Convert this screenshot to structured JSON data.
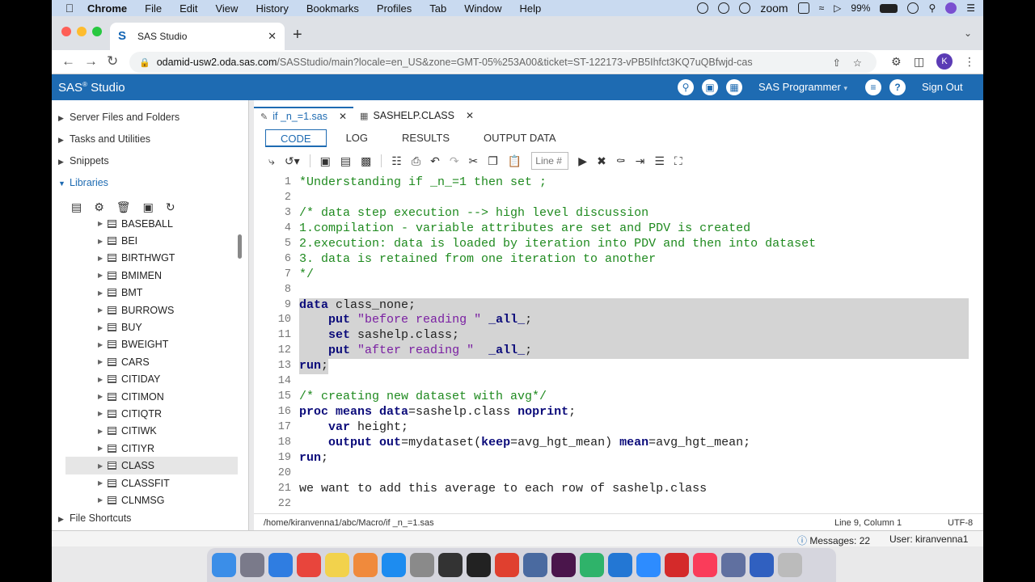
{
  "menubar": {
    "apple": "",
    "items": [
      "Chrome",
      "File",
      "Edit",
      "View",
      "History",
      "Bookmarks",
      "Profiles",
      "Tab",
      "Window",
      "Help"
    ],
    "zoom": "zoom",
    "battery": "99%",
    "time": ""
  },
  "browser": {
    "tab_title": "SAS Studio",
    "url_host": "odamid-usw2.oda.sas.com",
    "url_path": "/SASStudio/main?locale=en_US&zone=GMT-05%253A00&ticket=ST-122173-vPB5Ihfct3KQ7uQBfwjd-cas",
    "profile_initial": "K"
  },
  "sas_header": {
    "brand": "SAS",
    "brand_mark": "®",
    "brand_rest": " Studio",
    "mode": "SAS Programmer",
    "sign_out": "Sign Out"
  },
  "left_panel": {
    "sections": {
      "server_files": "Server Files and Folders",
      "tasks": "Tasks and Utilities",
      "snippets": "Snippets",
      "libraries": "Libraries",
      "file_shortcuts": "File Shortcuts"
    },
    "libraries": [
      "BASEBALL",
      "BEI",
      "BIRTHWGT",
      "BMIMEN",
      "BMT",
      "BURROWS",
      "BUY",
      "BWEIGHT",
      "CARS",
      "CITIDAY",
      "CITIMON",
      "CITIQTR",
      "CITIWK",
      "CITIYR",
      "CLASS",
      "CLASSFIT",
      "CLNMSG"
    ],
    "selected_library": "CLASS"
  },
  "editor": {
    "doc_tabs": [
      "if _n_=1.sas",
      "SASHELP.CLASS"
    ],
    "sub_tabs": [
      "CODE",
      "LOG",
      "RESULTS",
      "OUTPUT DATA"
    ],
    "line_placeholder": "Line #",
    "status_path": "/home/kiranvenna1/abc/Macro/if _n_=1.sas",
    "status_position": "Line 9, Column 1",
    "status_encoding": "UTF-8",
    "lines": [
      {
        "n": "1",
        "segs": [
          {
            "t": "*Understanding if _n_=1 then set ;",
            "c": "com"
          }
        ]
      },
      {
        "n": "2",
        "segs": []
      },
      {
        "n": "3",
        "segs": [
          {
            "t": "/* data step execution --> high level discussion",
            "c": "com"
          }
        ]
      },
      {
        "n": "4",
        "segs": [
          {
            "t": "1.compilation - variable attributes are set and PDV is created",
            "c": "com"
          }
        ]
      },
      {
        "n": "5",
        "segs": [
          {
            "t": "2.execution: data is loaded by iteration into PDV and then into dataset",
            "c": "com"
          }
        ]
      },
      {
        "n": "6",
        "segs": [
          {
            "t": "3. data is retained from one iteration to another",
            "c": "com"
          }
        ]
      },
      {
        "n": "7",
        "segs": [
          {
            "t": "*/",
            "c": "com"
          }
        ]
      },
      {
        "n": "8",
        "segs": []
      },
      {
        "n": "9",
        "hl": true,
        "segs": [
          {
            "t": "data",
            "c": "kw"
          },
          {
            "t": " class_none;",
            "c": "id"
          }
        ]
      },
      {
        "n": "10",
        "hl": true,
        "segs": [
          {
            "t": "    ",
            "c": "plain"
          },
          {
            "t": "put",
            "c": "kw"
          },
          {
            "t": " ",
            "c": "plain"
          },
          {
            "t": "\"before reading \"",
            "c": "str"
          },
          {
            "t": " ",
            "c": "plain"
          },
          {
            "t": "_all_",
            "c": "kw"
          },
          {
            "t": ";",
            "c": "plain"
          }
        ]
      },
      {
        "n": "11",
        "hl": true,
        "segs": [
          {
            "t": "    ",
            "c": "plain"
          },
          {
            "t": "set",
            "c": "kw"
          },
          {
            "t": " sashelp.class;",
            "c": "id"
          }
        ]
      },
      {
        "n": "12",
        "hl": true,
        "segs": [
          {
            "t": "    ",
            "c": "plain"
          },
          {
            "t": "put",
            "c": "kw"
          },
          {
            "t": " ",
            "c": "plain"
          },
          {
            "t": "\"after reading \"",
            "c": "str"
          },
          {
            "t": "  ",
            "c": "plain"
          },
          {
            "t": "_all_",
            "c": "kw"
          },
          {
            "t": ";",
            "c": "plain"
          }
        ]
      },
      {
        "n": "13",
        "hl2": true,
        "segs": [
          {
            "t": "run",
            "c": "kw"
          },
          {
            "t": ";",
            "c": "plain"
          }
        ]
      },
      {
        "n": "14",
        "segs": []
      },
      {
        "n": "15",
        "segs": [
          {
            "t": "/* creating new dataset with avg*/",
            "c": "com"
          }
        ]
      },
      {
        "n": "16",
        "segs": [
          {
            "t": "proc means",
            "c": "kw"
          },
          {
            "t": " ",
            "c": "plain"
          },
          {
            "t": "data",
            "c": "kw"
          },
          {
            "t": "=sashelp.class ",
            "c": "plain"
          },
          {
            "t": "noprint",
            "c": "kw"
          },
          {
            "t": ";",
            "c": "plain"
          }
        ]
      },
      {
        "n": "17",
        "segs": [
          {
            "t": "    ",
            "c": "plain"
          },
          {
            "t": "var",
            "c": "kw"
          },
          {
            "t": " height;",
            "c": "plain"
          }
        ]
      },
      {
        "n": "18",
        "segs": [
          {
            "t": "    ",
            "c": "plain"
          },
          {
            "t": "output",
            "c": "kw"
          },
          {
            "t": " ",
            "c": "plain"
          },
          {
            "t": "out",
            "c": "kw"
          },
          {
            "t": "=mydataset(",
            "c": "plain"
          },
          {
            "t": "keep",
            "c": "kw"
          },
          {
            "t": "=avg_hgt_mean) ",
            "c": "plain"
          },
          {
            "t": "mean",
            "c": "kw"
          },
          {
            "t": "=avg_hgt_mean;",
            "c": "plain"
          }
        ]
      },
      {
        "n": "19",
        "segs": [
          {
            "t": "run",
            "c": "kw"
          },
          {
            "t": ";",
            "c": "plain"
          }
        ]
      },
      {
        "n": "20",
        "segs": []
      },
      {
        "n": "21",
        "segs": [
          {
            "t": "we want to add this average to each row of sashelp.class",
            "c": "plain"
          }
        ]
      },
      {
        "n": "22",
        "segs": []
      }
    ]
  },
  "app_status": {
    "messages": "Messages: 22",
    "user": "User: kiranvenna1"
  },
  "dock": [
    "finder",
    "launchpad",
    "safari",
    "chrome",
    "notes",
    "photos",
    "app-store",
    "system-preferences",
    "piano",
    "terminal",
    "app",
    "app",
    "slack",
    "app",
    "vscode",
    "zoom",
    "acrobat",
    "music",
    "app",
    "app",
    "trash"
  ]
}
